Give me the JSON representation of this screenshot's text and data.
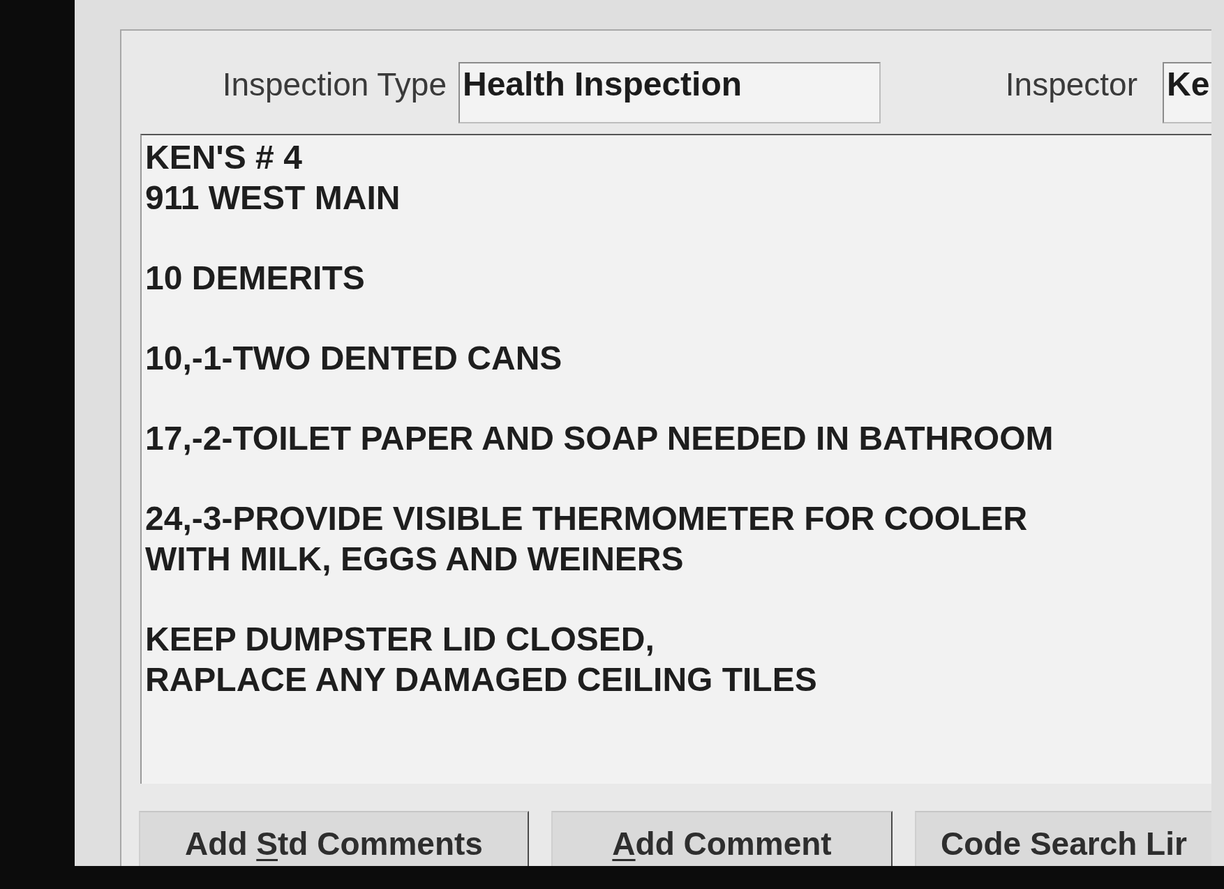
{
  "header_fields": [
    {
      "label": "Inspection Type",
      "value": "Health Inspection"
    },
    {
      "label": "Inspector",
      "value": "Ke"
    }
  ],
  "comments": {
    "paragraphs": [
      {
        "lines": [
          "KEN'S # 4",
          "911 WEST MAIN"
        ]
      },
      {
        "lines": [
          "10 DEMERITS"
        ]
      },
      {
        "lines": [
          "10,-1-TWO DENTED CANS"
        ]
      },
      {
        "lines": [
          "17,-2-TOILET PAPER AND SOAP NEEDED IN BATHROOM"
        ]
      },
      {
        "lines": [
          "24,-3-PROVIDE VISIBLE THERMOMETER FOR COOLER",
          "WITH MILK, EGGS AND WEINERS"
        ]
      },
      {
        "lines": [
          "KEEP DUMPSTER LID CLOSED,",
          "RAPLACE ANY DAMAGED CEILING TILES"
        ]
      }
    ]
  },
  "buttons": [
    {
      "label_parts": [
        {
          "text": "Add ",
          "underlined": false
        },
        {
          "text": "S",
          "underlined": true
        },
        {
          "text": "td Comments",
          "underlined": false
        }
      ]
    },
    {
      "label_parts": [
        {
          "text": "A",
          "underlined": true
        },
        {
          "text": "dd Comment",
          "underlined": false
        }
      ]
    },
    {
      "label_parts": [
        {
          "text": "Code Search Lir",
          "underlined": false
        }
      ]
    }
  ]
}
